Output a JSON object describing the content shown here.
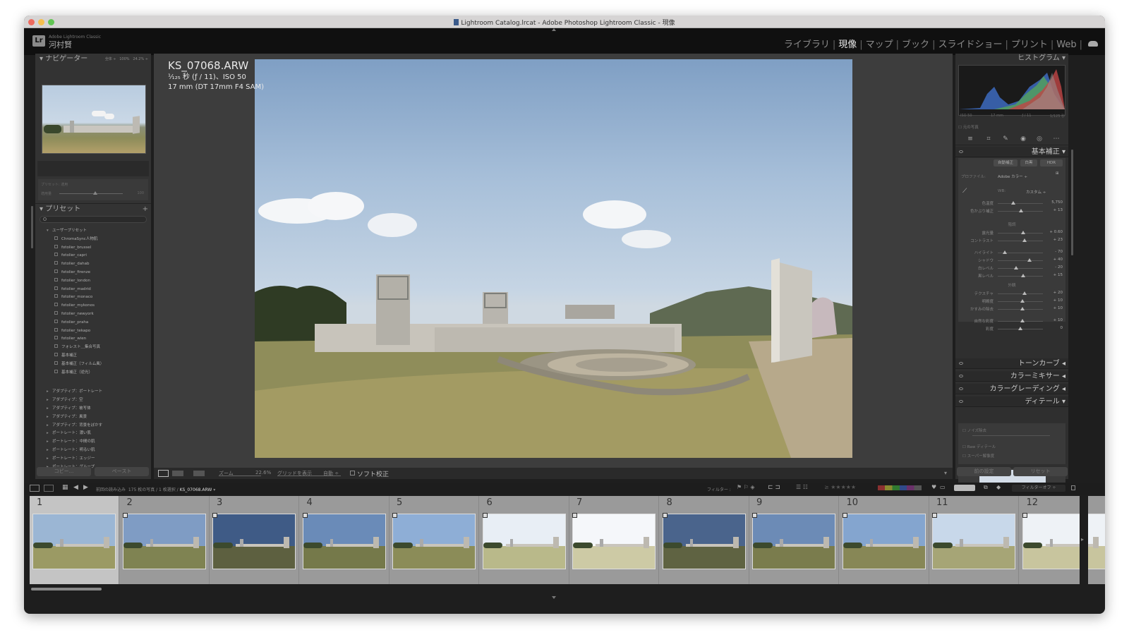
{
  "window": {
    "title": "Lightroom Catalog.lrcat - Adobe Photoshop Lightroom Classic - 現像"
  },
  "identity": {
    "product": "Adobe Lightroom Classic",
    "user": "河村賢"
  },
  "modules": [
    "ライブラリ",
    "現像",
    "マップ",
    "ブック",
    "スライドショー",
    "プリント",
    "Web"
  ],
  "active_module": "現像",
  "navigator": {
    "title": "ナビゲーター",
    "fit": "全体 ÷",
    "zoom1": "100%",
    "zoom2": "24.2% ÷"
  },
  "preset_amount": {
    "label": "プリセット: 適用",
    "sublabel": "適用量",
    "value": "100"
  },
  "presets": {
    "title": "プリセット",
    "user_group": "ユーザープリセット",
    "user_items": [
      "ChromaSync人物肌",
      "fotolier_brussel",
      "fotolier_capri",
      "fotolier_dahab",
      "fotolier_firenze",
      "fotolier_london",
      "fotolier_madrid",
      "fotolier_monaco",
      "fotolier_mykonos",
      "fotolier_newyork",
      "fotolier_praha",
      "fotolier_tekapo",
      "fotolier_wien",
      "フォレスト＿集合写真",
      "基本補正",
      "基本補正（フィルム風）",
      "基本補正（逆光）"
    ],
    "groups": [
      "アダプティブ：ポートレート",
      "アダプティブ：空",
      "アダプティブ：被写体",
      "アダプティブ：風景",
      "アダプティブ：背景をぼかす",
      "ポートレート：濃い肌",
      "ポートレート：中間の肌",
      "ポートレート：明るい肌",
      "ポートレート：エッジー",
      "ポートレート：グループ"
    ]
  },
  "left_footer": {
    "copy": "コピー...",
    "paste": "ペースト"
  },
  "photo": {
    "filename": "KS_07068.ARW",
    "exposure": "¹⁄₁₂₅ 秒 (ƒ / 11)、ISO 50",
    "lens": "17 mm (DT 17mm F4 SAM)"
  },
  "toolbar": {
    "zoom_label": "ズーム",
    "zoom_value": "22.6%",
    "grid_label": "グリッドを表示",
    "grid_value": "自動 ÷",
    "soft_proof": "ソフト校正"
  },
  "histogram": {
    "title": "ヒストグラム",
    "iso": "ISO 50",
    "focal": "17 mm",
    "aperture": "ƒ / 11",
    "shutter": "1/125 秒",
    "original": "元の写真"
  },
  "basic": {
    "title": "基本補正",
    "buttons": [
      "自動補正",
      "白黒",
      "HDR"
    ],
    "profile_label": "プロファイル:",
    "profile_value": "Adobe カラー ÷",
    "wb_label": "WB:",
    "wb_value": "カスタム ÷",
    "tone_group": "階調",
    "presence_group": "外観",
    "wb_sliders": [
      {
        "label": "色温度",
        "value": "5,750",
        "pos": 0.35
      },
      {
        "label": "色かぶり補正",
        "value": "+ 13",
        "pos": 0.52
      }
    ],
    "tone_sliders": [
      {
        "label": "露光量",
        "value": "+ 0.60",
        "pos": 0.56
      },
      {
        "label": "コントラスト",
        "value": "+ 23",
        "pos": 0.6
      },
      {
        "label": "ハイライト",
        "value": "- 70",
        "pos": 0.15
      },
      {
        "label": "シャドウ",
        "value": "+ 40",
        "pos": 0.7
      },
      {
        "label": "白レベル",
        "value": "- 20",
        "pos": 0.4
      },
      {
        "label": "黒レベル",
        "value": "+ 15",
        "pos": 0.57
      }
    ],
    "presence_sliders": [
      {
        "label": "テクスチャ",
        "value": "+ 20",
        "pos": 0.6
      },
      {
        "label": "明瞭度",
        "value": "+ 10",
        "pos": 0.55
      },
      {
        "label": "かすみの除去",
        "value": "+ 10",
        "pos": 0.55
      },
      {
        "label": "自然な彩度",
        "value": "+ 10",
        "pos": 0.55
      },
      {
        "label": "彩度",
        "value": "0",
        "pos": 0.5
      }
    ]
  },
  "panels": [
    "トーンカーブ",
    "カラーミキサー",
    "カラーグレーディング",
    "ディテール"
  ],
  "detail": {
    "noise": "ノイズ除去",
    "raw_detail": "Raw ディテール",
    "super_res": "スーパー解像度"
  },
  "right_footer": {
    "previous": "前の設定",
    "reset": "リセット"
  },
  "filmbar": {
    "source": "前回の読み込み",
    "count": "175 枚の写真 / 1 枚選択 /",
    "file": "KS_07068.ARW",
    "filter": "フィルター :",
    "filter_off": "フィルターオフ"
  },
  "filmstrip": [
    {
      "num": "1",
      "sky": "#9bb6d4",
      "grass": "#9b9a64",
      "selected": true
    },
    {
      "num": "2",
      "sky": "#7f9cc4",
      "grass": "#7f8352"
    },
    {
      "num": "3",
      "sky": "#3f5b86",
      "grass": "#5d6040"
    },
    {
      "num": "4",
      "sky": "#6a8bb8",
      "grass": "#75794a"
    },
    {
      "num": "5",
      "sky": "#8eaed6",
      "grass": "#8b8c58"
    },
    {
      "num": "6",
      "sky": "#e8eef5",
      "grass": "#b9b98a"
    },
    {
      "num": "7",
      "sky": "#f5f7fa",
      "grass": "#cdcaa5"
    },
    {
      "num": "8",
      "sky": "#4a648c",
      "grass": "#5f6342"
    },
    {
      "num": "9",
      "sky": "#6c8bb6",
      "grass": "#7a7c4d"
    },
    {
      "num": "10",
      "sky": "#84a5cf",
      "grass": "#878756"
    },
    {
      "num": "11",
      "sky": "#c8d8ea",
      "grass": "#a6a576"
    },
    {
      "num": "12",
      "sky": "#eef2f6",
      "grass": "#c8c59e"
    }
  ]
}
